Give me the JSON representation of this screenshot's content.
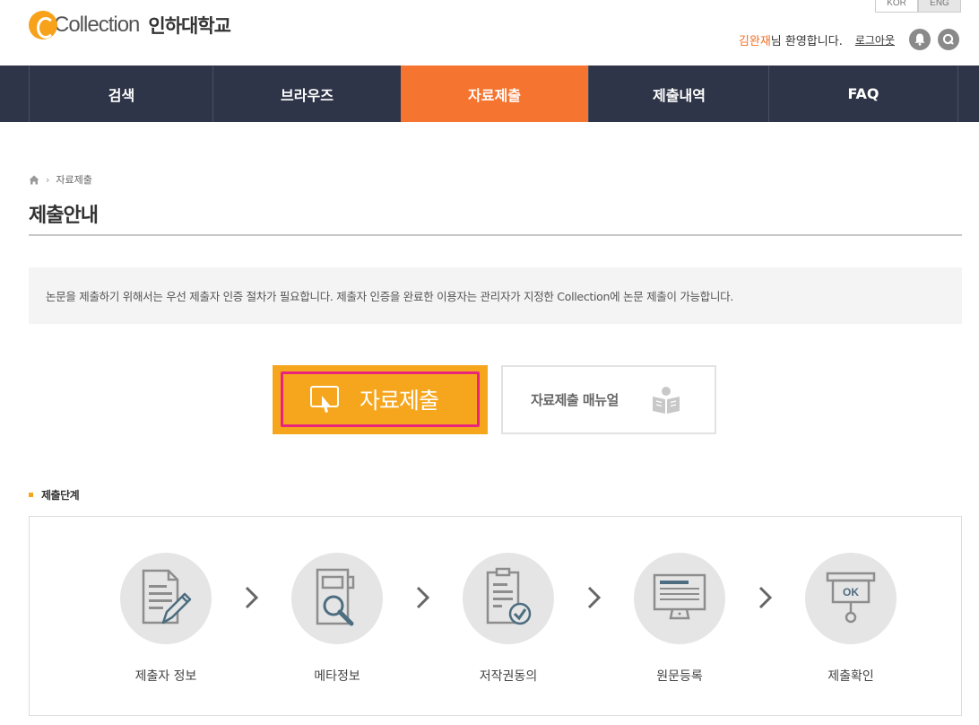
{
  "header": {
    "lang": [
      "KOR",
      "ENG"
    ],
    "logo_text": "Collection",
    "university": "인하대학교",
    "user_name": "김완재",
    "welcome": "님 환영합니다.",
    "logout": "로그아웃"
  },
  "nav": {
    "items": [
      {
        "label": "검색"
      },
      {
        "label": "브라우즈"
      },
      {
        "label": "자료제출",
        "active": true
      },
      {
        "label": "제출내역"
      },
      {
        "label": "FAQ"
      }
    ]
  },
  "breadcrumb": {
    "current": "자료제출"
  },
  "page": {
    "title": "제출안내",
    "notice": "논문을 제출하기 위해서는 우선 제출자 인증 절차가 필요합니다. 제출자 인증을 완료한 이용자는 관리자가 지정한 Collection에 논문 제출이 가능합니다.",
    "submit_button": "자료제출",
    "manual_button": "자료제출 매뉴얼"
  },
  "steps": {
    "title": "제출단계",
    "items": [
      {
        "label": "제출자 정보",
        "icon": "document-pen-icon"
      },
      {
        "label": "메타정보",
        "icon": "document-search-icon"
      },
      {
        "label": "저작권동의",
        "icon": "document-check-icon"
      },
      {
        "label": "원문등록",
        "icon": "monitor-icon"
      },
      {
        "label": "제출확인",
        "icon": "ok-sign-icon"
      }
    ]
  },
  "colors": {
    "nav_bg": "#2f3548",
    "nav_active": "#f57430",
    "submit_bg": "#f6a61c",
    "highlight": "#e8247c",
    "user_name": "#f26d21"
  }
}
